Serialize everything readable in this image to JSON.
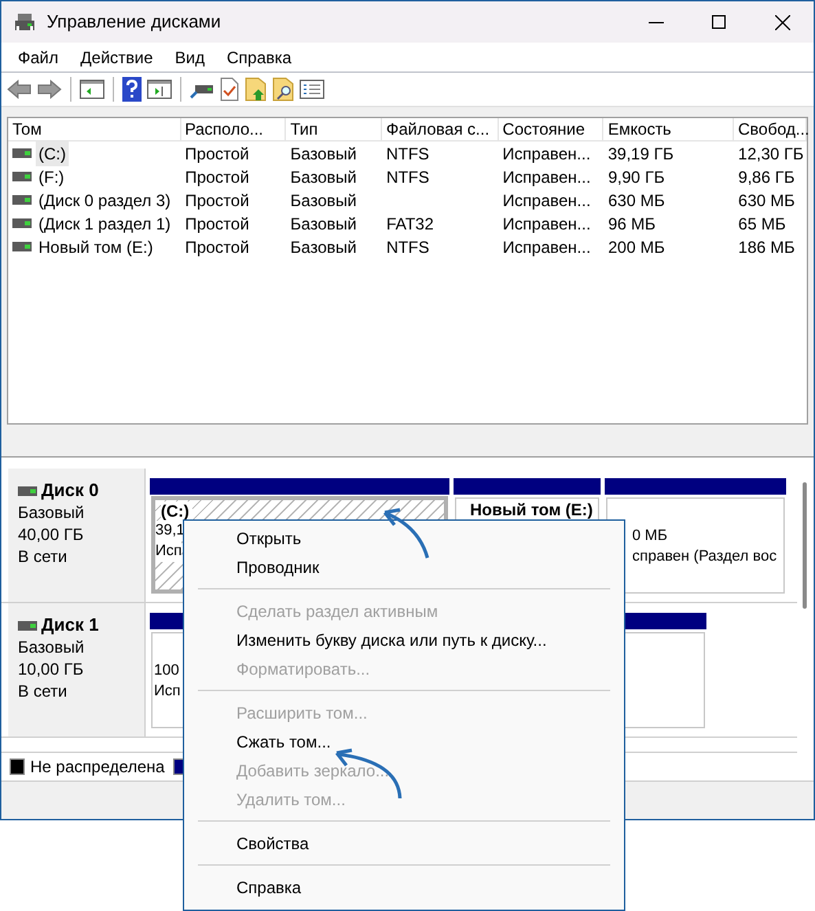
{
  "window": {
    "title": "Управление дисками"
  },
  "menu": [
    "Файл",
    "Действие",
    "Вид",
    "Справка"
  ],
  "table": {
    "columns": [
      "Том",
      "Располо...",
      "Тип",
      "Файловая с...",
      "Состояние",
      "Емкость",
      "Свобод..."
    ],
    "rows": [
      {
        "cells": [
          "(C:)",
          "Простой",
          "Базовый",
          "NTFS",
          "Исправен...",
          "39,19 ГБ",
          "12,30 ГБ"
        ],
        "selected": true
      },
      {
        "cells": [
          "(F:)",
          "Простой",
          "Базовый",
          "NTFS",
          "Исправен...",
          "9,90 ГБ",
          "9,86 ГБ"
        ],
        "selected": false
      },
      {
        "cells": [
          "(Диск 0 раздел 3)",
          "Простой",
          "Базовый",
          "",
          "Исправен...",
          "630 МБ",
          "630 МБ"
        ],
        "selected": false
      },
      {
        "cells": [
          "(Диск 1 раздел 1)",
          "Простой",
          "Базовый",
          "FAT32",
          "Исправен...",
          "96 МБ",
          "65 МБ"
        ],
        "selected": false
      },
      {
        "cells": [
          "Новый том (E:)",
          "Простой",
          "Базовый",
          "NTFS",
          "Исправен...",
          "200 МБ",
          "186 МБ"
        ],
        "selected": false
      }
    ]
  },
  "disks": [
    {
      "name": "Диск 0",
      "type": "Базовый",
      "size": "40,00 ГБ",
      "status": "В сети",
      "partitions": [
        {
          "label": "(C:)",
          "lines": [
            "39,1",
            "Исп"
          ],
          "selected": true
        },
        {
          "label": "Новый том  (E:)",
          "selected": false
        },
        {
          "lines": [
            "0 МБ",
            "справен (Раздел вос"
          ],
          "selected": false
        }
      ]
    },
    {
      "name": "Диск 1",
      "type": "Базовый",
      "size": "10,00 ГБ",
      "status": "В сети",
      "partitions": [
        {
          "lines": [
            "100",
            "Исп"
          ],
          "selected": false
        }
      ]
    }
  ],
  "legend": [
    {
      "label": "Не распределена",
      "color": "#000000"
    },
    {
      "color": "#000080"
    }
  ],
  "context_menu": [
    {
      "kind": "item",
      "label": "Открыть",
      "disabled": false
    },
    {
      "kind": "item",
      "label": "Проводник",
      "disabled": false
    },
    {
      "kind": "separator"
    },
    {
      "kind": "item",
      "label": "Сделать раздел активным",
      "disabled": true
    },
    {
      "kind": "item",
      "label": "Изменить букву диска или путь к диску...",
      "disabled": false
    },
    {
      "kind": "item",
      "label": "Форматировать...",
      "disabled": true
    },
    {
      "kind": "separator"
    },
    {
      "kind": "item",
      "label": "Расширить том...",
      "disabled": true
    },
    {
      "kind": "item",
      "label": "Сжать том...",
      "disabled": false
    },
    {
      "kind": "item",
      "label": "Добавить зеркало...",
      "disabled": true
    },
    {
      "kind": "item",
      "label": "Удалить том...",
      "disabled": true
    },
    {
      "kind": "separator"
    },
    {
      "kind": "item",
      "label": "Свойства",
      "disabled": false
    },
    {
      "kind": "separator"
    },
    {
      "kind": "item",
      "label": "Справка",
      "disabled": false
    }
  ]
}
